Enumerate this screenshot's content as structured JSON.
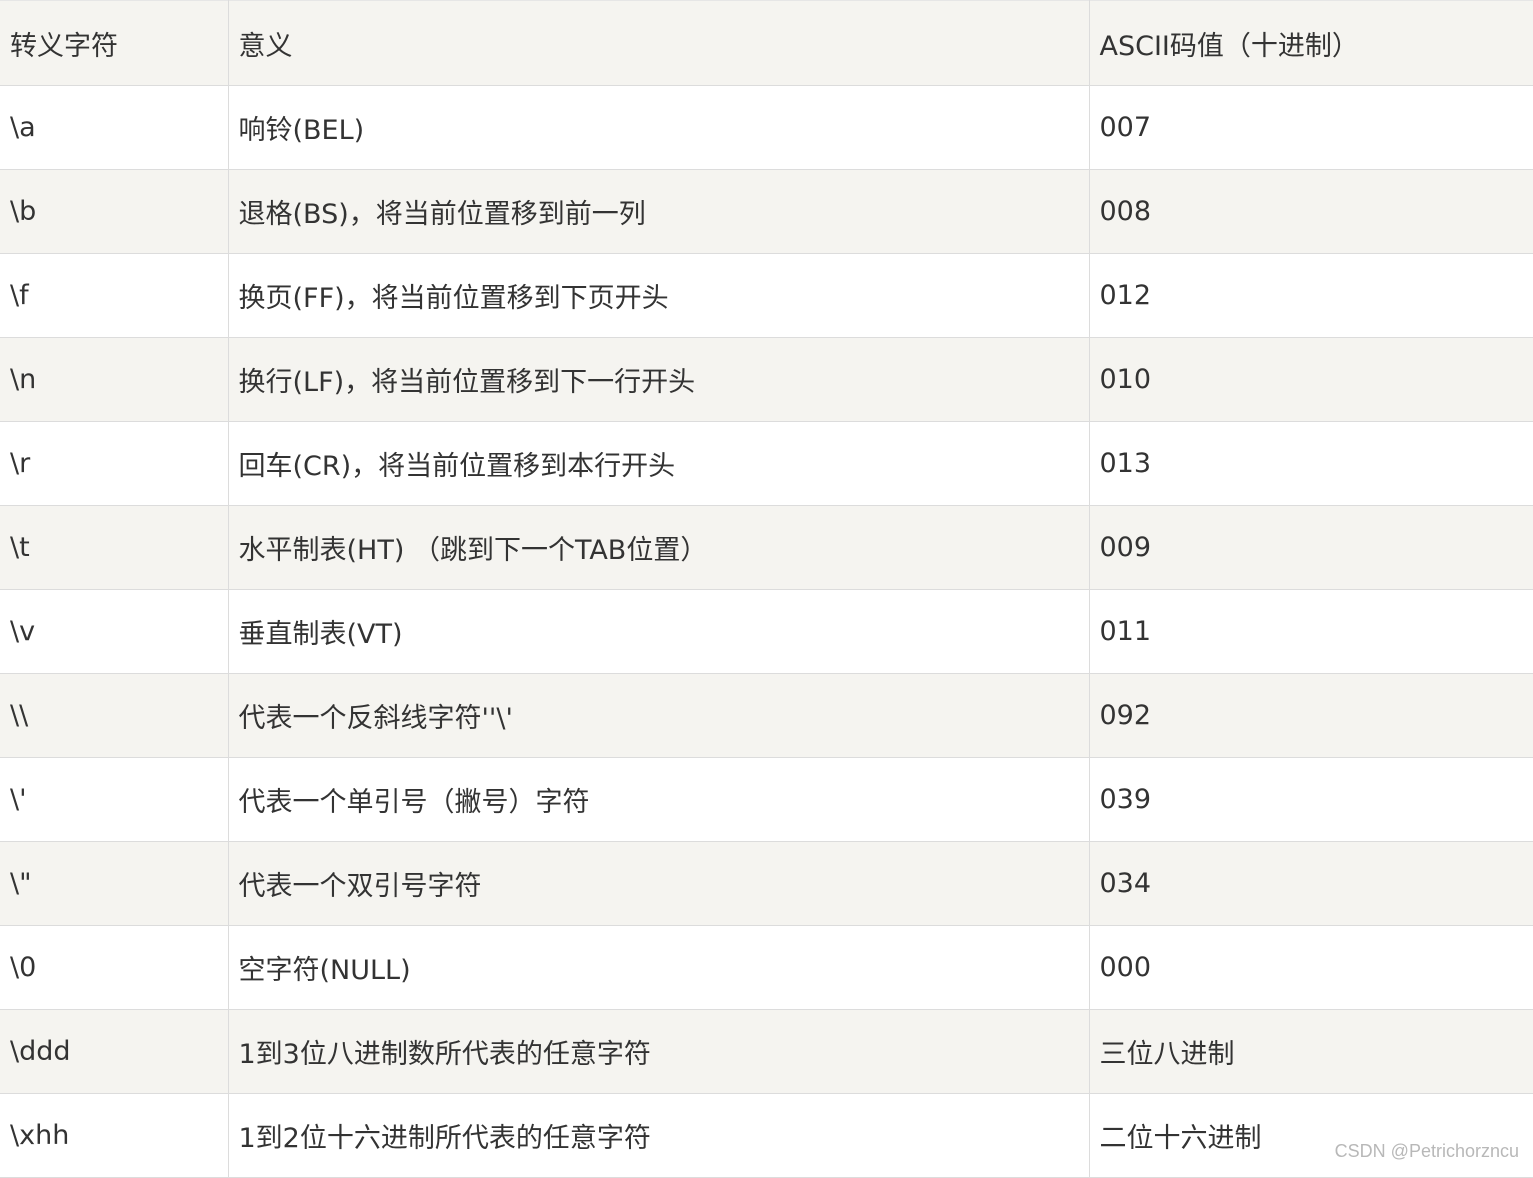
{
  "table": {
    "headers": [
      "转义字符",
      "意义",
      "ASCII码值（十进制）"
    ],
    "rows": [
      [
        "\\a",
        "响铃(BEL)",
        "007"
      ],
      [
        "\\b",
        "退格(BS)，将当前位置移到前一列",
        "008"
      ],
      [
        "\\f",
        "换页(FF)，将当前位置移到下页开头",
        "012"
      ],
      [
        "\\n",
        "换行(LF)，将当前位置移到下一行开头",
        "010"
      ],
      [
        "\\r",
        "回车(CR)，将当前位置移到本行开头",
        "013"
      ],
      [
        "\\t",
        "水平制表(HT) （跳到下一个TAB位置）",
        "009"
      ],
      [
        "\\v",
        "垂直制表(VT)",
        "011"
      ],
      [
        "\\\\",
        "代表一个反斜线字符''\\'",
        "092"
      ],
      [
        "\\'",
        "代表一个单引号（撇号）字符",
        "039"
      ],
      [
        "\\\"",
        "代表一个双引号字符",
        "034"
      ],
      [
        "\\0",
        "空字符(NULL)",
        "000"
      ],
      [
        "\\ddd",
        "1到3位八进制数所代表的任意字符",
        "三位八进制"
      ],
      [
        "\\xhh",
        "1到2位十六进制所代表的任意字符",
        "二位十六进制"
      ]
    ]
  },
  "watermark": "CSDN @Petrichorzncu"
}
